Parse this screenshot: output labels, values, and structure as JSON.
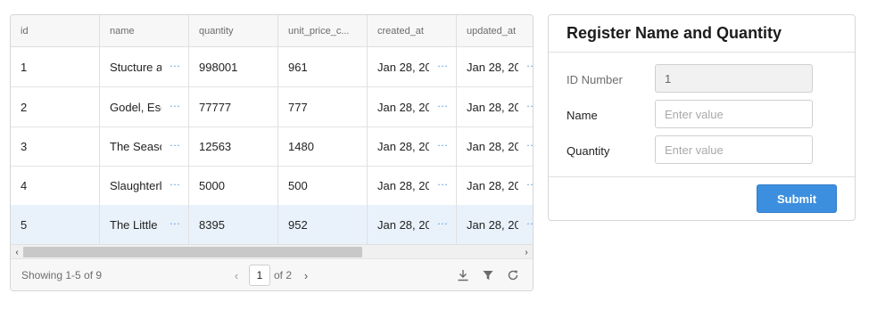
{
  "table": {
    "columns": [
      "id",
      "name",
      "quantity",
      "unit_price_c...",
      "created_at",
      "updated_at"
    ],
    "rows": [
      {
        "id": "1",
        "name": "Stucture a",
        "quantity": "998001",
        "unit_price": "961",
        "created_at": "Jan 28, 20",
        "updated_at": "Jan 28, 20"
      },
      {
        "id": "2",
        "name": "Godel, Esc",
        "quantity": "77777",
        "unit_price": "777",
        "created_at": "Jan 28, 20",
        "updated_at": "Jan 28, 20"
      },
      {
        "id": "3",
        "name": "The Seasc",
        "quantity": "12563",
        "unit_price": "1480",
        "created_at": "Jan 28, 20",
        "updated_at": "Jan 28, 20"
      },
      {
        "id": "4",
        "name": "Slaughterl",
        "quantity": "5000",
        "unit_price": "500",
        "created_at": "Jan 28, 20",
        "updated_at": "Jan 28, 20"
      },
      {
        "id": "5",
        "name": "The Little",
        "quantity": "8395",
        "unit_price": "952",
        "created_at": "Jan 28, 20",
        "updated_at": "Jan 28, 20"
      }
    ],
    "selected_row": 5,
    "more_glyph": "···",
    "scroll_left_glyph": "‹",
    "scroll_right_glyph": "›",
    "footer": {
      "showing": "Showing 1-5 of 9",
      "prev_glyph": "‹",
      "page": "1",
      "of_pages": "of 2",
      "next_glyph": "›"
    },
    "icons": [
      "download-icon",
      "filter-icon",
      "refresh-icon"
    ]
  },
  "form": {
    "title": "Register Name and Quantity",
    "fields": [
      {
        "label": "ID Number",
        "value": "1",
        "placeholder": "",
        "disabled": true
      },
      {
        "label": "Name",
        "value": "",
        "placeholder": "Enter value",
        "disabled": false
      },
      {
        "label": "Quantity",
        "value": "",
        "placeholder": "Enter value",
        "disabled": false
      }
    ],
    "submit_label": "Submit"
  },
  "colors": {
    "accent": "#3c8fde",
    "selected_row": "#e9f2fb",
    "ellipsis": "#4a90d9"
  }
}
